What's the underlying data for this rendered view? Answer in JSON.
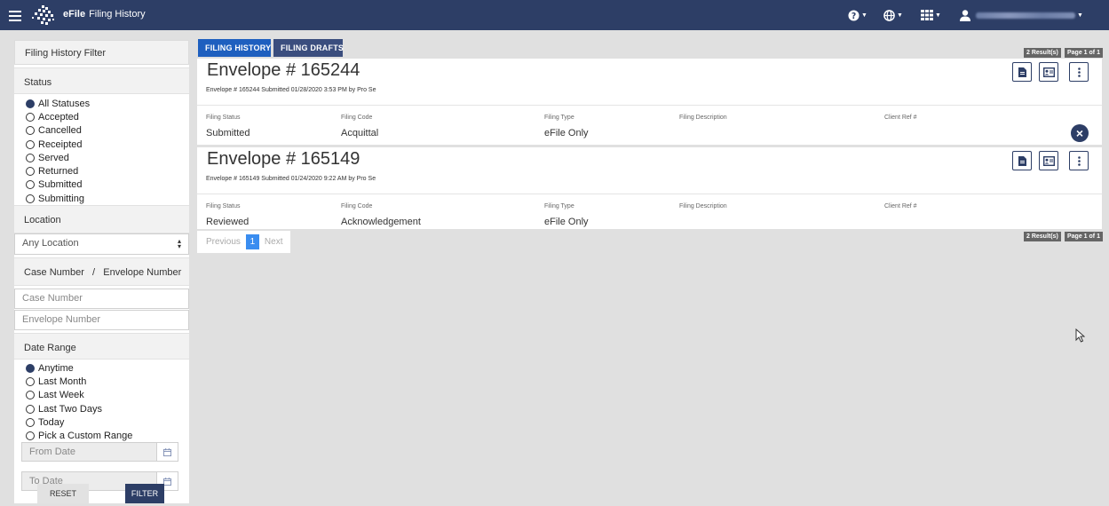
{
  "header": {
    "app_name": "eFile",
    "page_title": "Filing History"
  },
  "sidebar": {
    "title": "Filing History Filter",
    "status": {
      "label": "Status",
      "options": [
        "All Statuses",
        "Accepted",
        "Cancelled",
        "Receipted",
        "Served",
        "Returned",
        "Submitted",
        "Submitting"
      ],
      "selected": "All Statuses"
    },
    "location": {
      "label": "Location",
      "selected": "Any Location"
    },
    "case_envelope": {
      "label": "Case Number   /   Envelope Number",
      "case_placeholder": "Case Number",
      "envelope_placeholder": "Envelope Number"
    },
    "date_range": {
      "label": "Date Range",
      "options": [
        "Anytime",
        "Last Month",
        "Last Week",
        "Last Two Days",
        "Today",
        "Pick a Custom Range"
      ],
      "selected": "Anytime",
      "from_placeholder": "From Date",
      "to_placeholder": "To Date"
    },
    "reset_label": "RESET",
    "filter_label": "FILTER"
  },
  "tabs": {
    "history": "FILING HISTORY",
    "drafts": "FILING DRAFTS"
  },
  "summary": {
    "results": "2 Result(s)",
    "page": "Page 1 of 1"
  },
  "columns": {
    "status": "Filing Status",
    "code": "Filing Code",
    "type": "Filing Type",
    "description": "Filing Description",
    "client_ref": "Client Ref #"
  },
  "envelopes": [
    {
      "title": "Envelope # 165244",
      "subtitle": "Envelope # 165244 Submitted 01/28/2020 3:53 PM by Pro Se",
      "status": "Submitted",
      "code": "Acquittal",
      "type": "eFile Only",
      "description": "",
      "client_ref": ""
    },
    {
      "title": "Envelope # 165149",
      "subtitle": "Envelope # 165149 Submitted 01/24/2020 9:22 AM by Pro Se",
      "status": "Reviewed",
      "code": "Acknowledgement",
      "type": "eFile Only",
      "description": "",
      "client_ref": ""
    }
  ],
  "pagination": {
    "previous": "Previous",
    "current": "1",
    "next": "Next"
  },
  "colors": {
    "navbar": "#2d3e66",
    "tab_active": "#1e5fbf",
    "page_active": "#3a8df0"
  }
}
